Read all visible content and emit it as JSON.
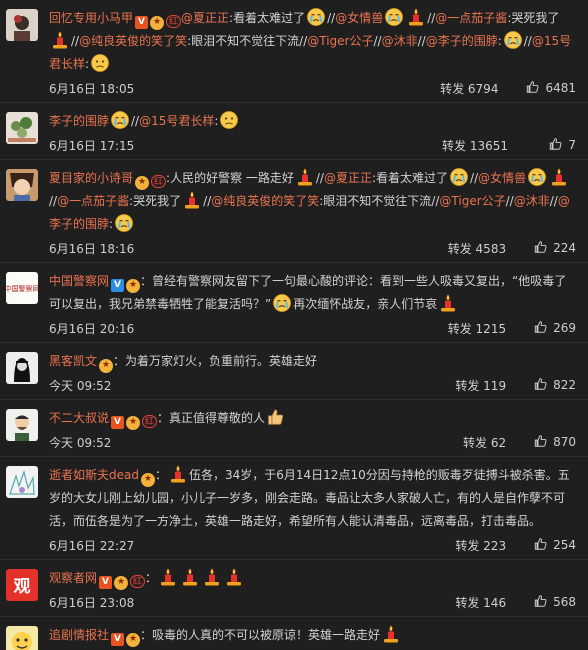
{
  "comments": [
    {
      "user": "回忆专用小马甲",
      "time": "6月16日 18:05",
      "repost": "转发 6794",
      "likes": "6481",
      "segments": [
        {
          "t": "@夏正正",
          "m": true
        },
        {
          "t": ":看着太难过了"
        },
        {
          "e": "cry"
        },
        {
          "t": "//"
        },
        {
          "t": "@女情兽",
          "m": true
        },
        {
          "e": "cry"
        },
        {
          "e": "candle"
        },
        {
          "t": "//"
        },
        {
          "t": "@一点茄子酱",
          "m": true
        },
        {
          "t": ":哭死我了"
        },
        {
          "e": "candle"
        },
        {
          "t": "//"
        },
        {
          "t": "@纯良英俊的笑了笑",
          "m": true
        },
        {
          "t": ":眼泪不知不觉往下流"
        },
        {
          "t": "//"
        },
        {
          "t": "@Tiger公子",
          "m": true
        },
        {
          "t": "//"
        },
        {
          "t": "@沐非",
          "m": true
        },
        {
          "t": "//"
        },
        {
          "t": "@李子的围脖",
          "m": true
        },
        {
          "t": ":"
        },
        {
          "e": "cry"
        },
        {
          "t": "//"
        },
        {
          "t": "@15号君长样",
          "m": true
        },
        {
          "t": ":"
        },
        {
          "e": "sad"
        }
      ]
    },
    {
      "user": "李子的围脖",
      "time": "6月16日 17:15",
      "repost": "转发 13651",
      "likes": "7",
      "segments": [
        {
          "e": "cry"
        },
        {
          "t": "//"
        },
        {
          "t": "@15号君长样",
          "m": true
        },
        {
          "t": ":"
        },
        {
          "e": "sad"
        }
      ]
    },
    {
      "user": "夏目家的小诗哥",
      "time": "6月16日 18:16",
      "repost": "转发 4583",
      "likes": "224",
      "segments": [
        {
          "t": ":人民的好警察 一路走好"
        },
        {
          "e": "candle"
        },
        {
          "t": "//"
        },
        {
          "t": "@夏正正",
          "m": true
        },
        {
          "t": ":看着太难过了"
        },
        {
          "e": "cry"
        },
        {
          "t": "//"
        },
        {
          "t": "@女情兽",
          "m": true
        },
        {
          "e": "cry"
        },
        {
          "e": "candle"
        },
        {
          "t": "//"
        },
        {
          "t": "@一点茄子酱",
          "m": true
        },
        {
          "t": ":哭死我了"
        },
        {
          "e": "candle"
        },
        {
          "t": "//"
        },
        {
          "t": "@纯良英俊的笑了笑",
          "m": true
        },
        {
          "t": ":眼泪不知不觉往下流"
        },
        {
          "t": "//"
        },
        {
          "t": "@Tiger公子",
          "m": true
        },
        {
          "t": "//"
        },
        {
          "t": "@沐非",
          "m": true
        },
        {
          "t": "//"
        },
        {
          "t": "@李子的围脖",
          "m": true
        },
        {
          "t": ":"
        },
        {
          "e": "cry"
        }
      ]
    },
    {
      "user": "中国警察网",
      "time": "6月16日 20:16",
      "repost": "转发 1215",
      "likes": "269",
      "segments": [
        {
          "t": "：曾经有警察网友留下了一句最心酸的评论：看到一些人吸毒又复出，“他吸毒了可以复出，我兄弟禁毒牺牲了能复活吗？”"
        },
        {
          "e": "cry"
        },
        {
          "t": "再次缅怀战友，亲人们节哀"
        },
        {
          "e": "candle"
        }
      ]
    },
    {
      "user": "黑客凯文",
      "time": "今天 09:52",
      "repost": "转发 119",
      "likes": "822",
      "segments": [
        {
          "t": "：为着万家灯火，负重前行。英雄走好"
        }
      ]
    },
    {
      "user": "不二大叔说",
      "time": "今天 09:52",
      "repost": "转发 62",
      "likes": "870",
      "segments": [
        {
          "t": "：真正值得尊敬的人"
        },
        {
          "e": "thumb"
        }
      ]
    },
    {
      "user": "逝者如斯夫dead",
      "time": "6月16日 22:27",
      "repost": "转发 223",
      "likes": "254",
      "segments": [
        {
          "t": "："
        },
        {
          "e": "candle"
        },
        {
          "t": "伍各，34岁，于6月14日12点10分因与持枪的贩毒歹徒搏斗被杀害。五岁的大女儿刚上幼儿园，小儿子一岁多，刚会走路。毒品让太多人家破人亡，有的人是自作孽不可活，而伍各是为了一方净土，英雄一路走好，希望所有人能认清毒品，远离毒品，打击毒品。"
        }
      ]
    },
    {
      "user": "观察者网",
      "time": "6月16日 23:08",
      "repost": "转发 146",
      "likes": "568",
      "segments": [
        {
          "t": "："
        },
        {
          "e": "candle"
        },
        {
          "e": "candle"
        },
        {
          "e": "candle"
        },
        {
          "e": "candle"
        }
      ]
    },
    {
      "user": "追剧情报社",
      "time": "6月16日 18:27",
      "repost": "转发 74",
      "likes": "650",
      "segments": [
        {
          "t": "：吸毒的人真的不可以被原谅！英雄一路走好"
        },
        {
          "e": "candle"
        }
      ]
    }
  ],
  "badges": {
    "v_label": "V",
    "hong_label": "红"
  }
}
